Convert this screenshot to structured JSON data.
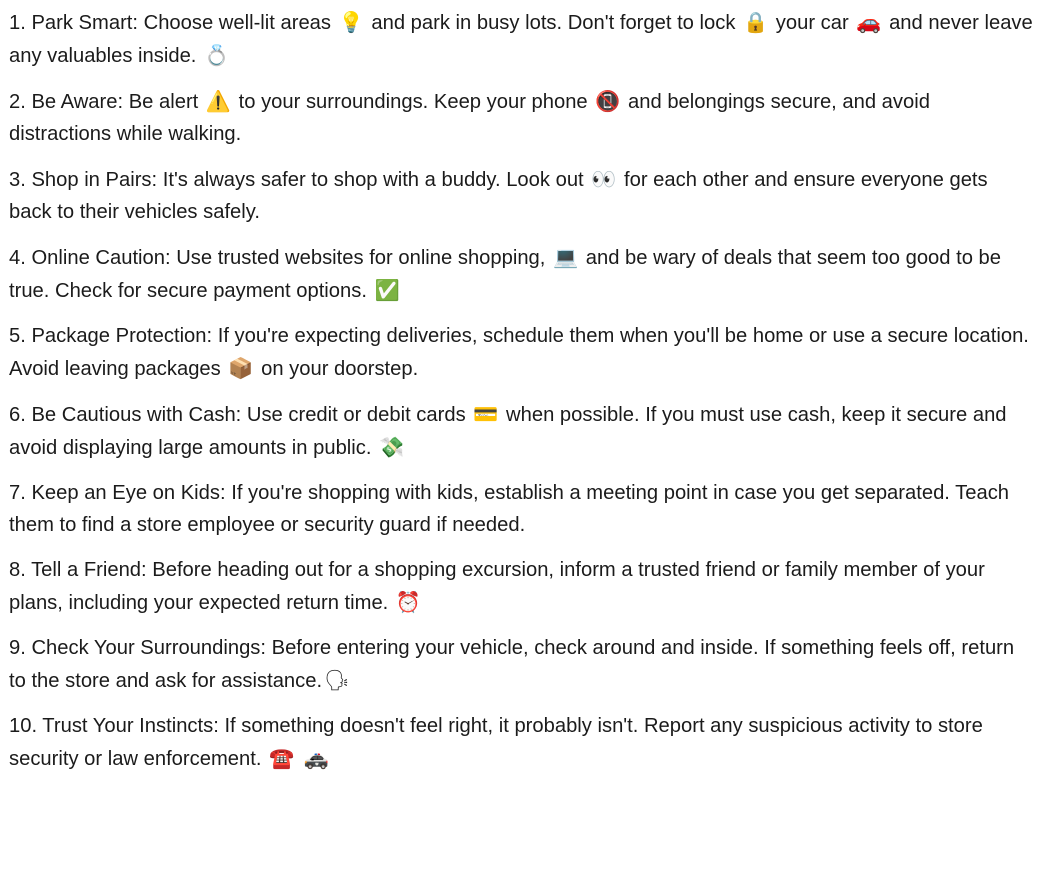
{
  "tips": [
    {
      "parts": [
        "1. Park Smart: Choose well-lit areas ",
        {
          "emoji": "💡",
          "name": "light-bulb-icon"
        },
        " and park in busy lots. Don't forget to lock ",
        {
          "emoji": "🔒",
          "name": "lock-icon"
        },
        " your car ",
        {
          "emoji": "🚗",
          "name": "car-icon"
        },
        " and never leave any valuables inside. ",
        {
          "emoji": "💍",
          "name": "ring-icon"
        }
      ]
    },
    {
      "parts": [
        "2. Be Aware: Be alert ",
        {
          "emoji": "⚠️",
          "name": "warning-icon"
        },
        " to your surroundings. Keep your phone ",
        {
          "emoji": "📵",
          "name": "no-phones-icon"
        },
        " and belongings secure, and avoid distractions while walking."
      ]
    },
    {
      "parts": [
        "3. Shop in Pairs: It's always safer to shop with a buddy. Look out ",
        {
          "emoji": "👀",
          "name": "eyes-icon"
        },
        " for each other and ensure everyone gets back to their vehicles safely."
      ]
    },
    {
      "parts": [
        "4. Online Caution: Use trusted websites for online shopping, ",
        {
          "emoji": "💻",
          "name": "laptop-icon"
        },
        " and be wary of deals that seem too good to be true. Check for secure payment options. ",
        {
          "emoji": "✅",
          "name": "check-mark-icon"
        }
      ]
    },
    {
      "parts": [
        "5. Package Protection: If you're expecting deliveries, schedule them when you'll be home or use a secure location. Avoid leaving packages ",
        {
          "emoji": "📦",
          "name": "package-icon"
        },
        " on your doorstep."
      ]
    },
    {
      "parts": [
        "6. Be Cautious with Cash: Use credit or debit cards ",
        {
          "emoji": "💳",
          "name": "credit-card-icon"
        },
        " when possible. If you must use cash, keep it secure and avoid displaying large amounts in public. ",
        {
          "emoji": "💸",
          "name": "money-with-wings-icon"
        }
      ]
    },
    {
      "parts": [
        "7. Keep an Eye on Kids: If you're shopping with kids, establish a meeting point in case you get separated. Teach them to find a store employee or security guard if needed."
      ]
    },
    {
      "parts": [
        "8. Tell a Friend: Before heading out for a shopping excursion, inform a trusted friend or family member of your plans, including your expected return time. ",
        {
          "emoji": "⏰",
          "name": "alarm-clock-icon"
        }
      ]
    },
    {
      "parts": [
        "9. Check Your Surroundings: Before entering your vehicle, check around and inside. If something feels off, return to the store and ask for assistance.",
        {
          "emoji": "🗣",
          "name": "speaking-head-icon"
        }
      ]
    },
    {
      "parts": [
        "10. Trust Your Instincts: If something doesn't feel right, it probably isn't. Report any suspicious activity to store security or law enforcement. ",
        {
          "emoji": "☎️",
          "name": "telephone-icon"
        },
        " ",
        {
          "emoji": "🚓",
          "name": "police-car-icon"
        }
      ]
    }
  ]
}
